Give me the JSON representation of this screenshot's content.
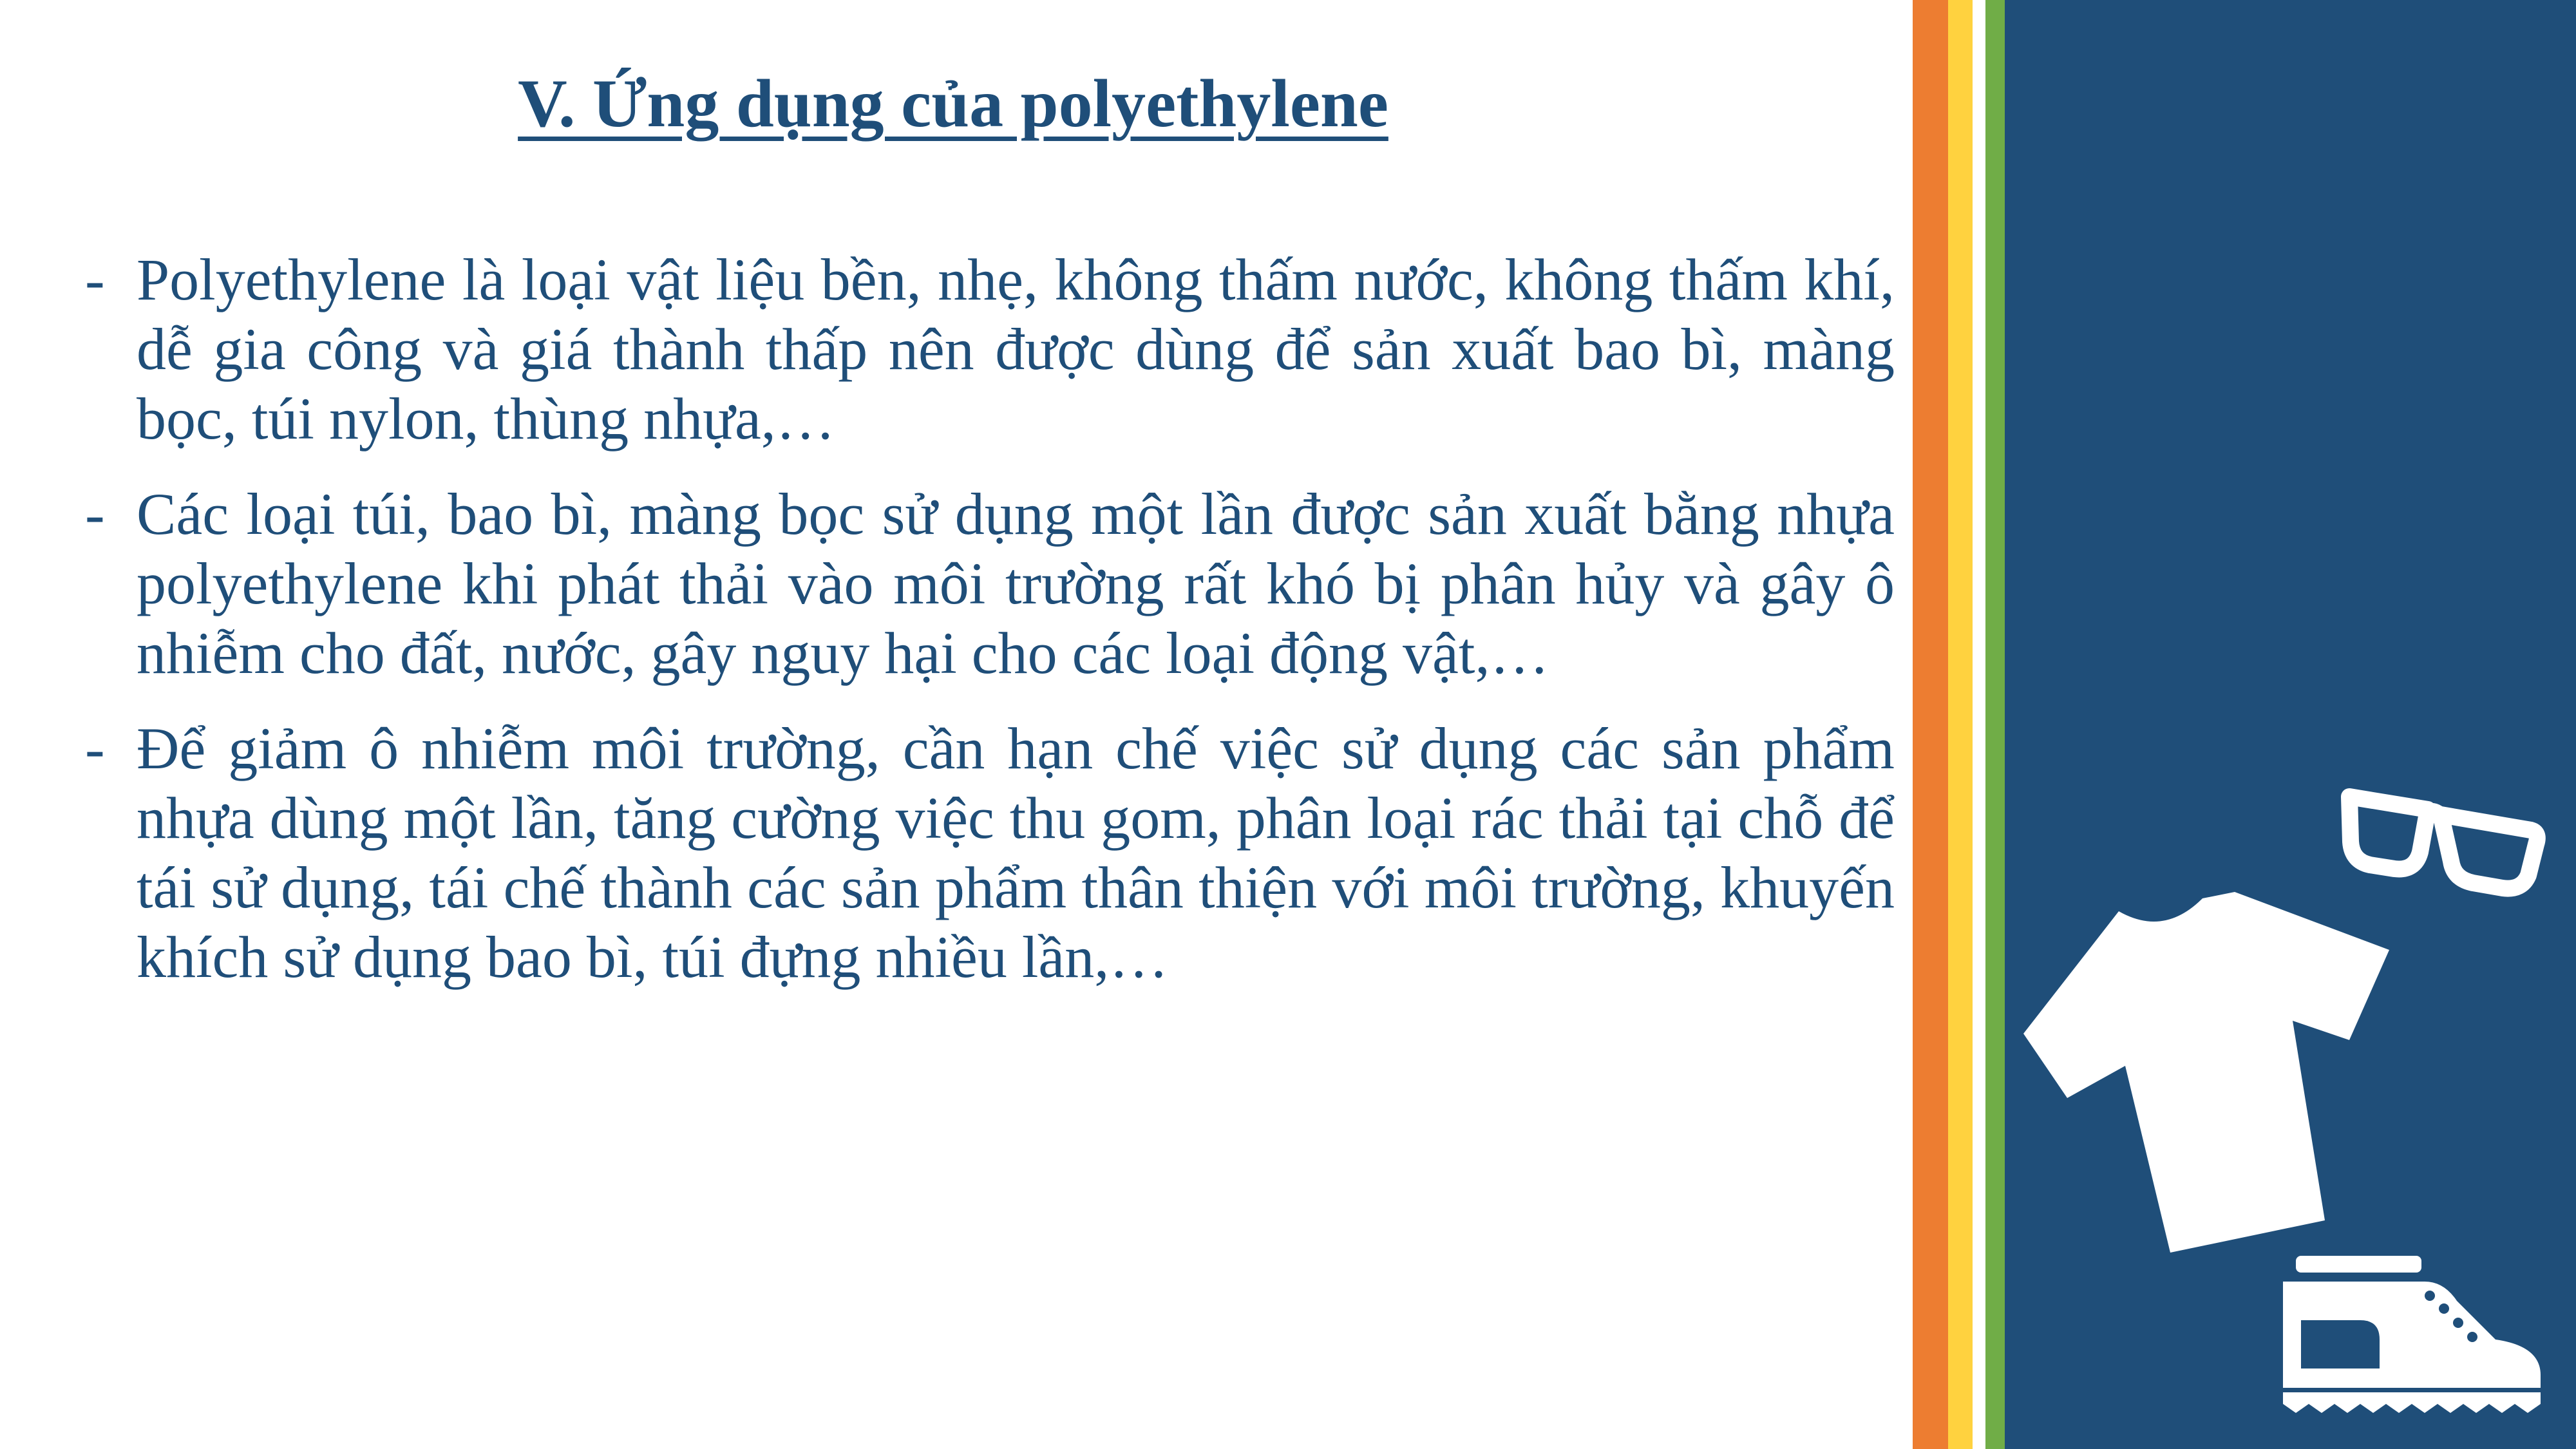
{
  "slide": {
    "title": "V. Ứng dụng của polyethylene",
    "bullet_marker": "-",
    "bullets": [
      "Polyethylene là loại vật liệu bền, nhẹ, không thấm nước, không thấm khí, dễ gia công và giá thành thấp nên được dùng để sản xuất bao bì, màng bọc, túi nylon, thùng nhựa,…",
      "Các loại túi, bao bì, màng bọc sử dụng một lần được sản xuất bằng nhựa polyethylene khi phát thải vào môi trường rất khó bị phân hủy và gây ô nhiễm cho đất, nước, gây nguy hại cho các loại động vật,…",
      "Để giảm ô nhiễm môi trường, cần hạn chế việc sử dụng các sản phẩm nhựa dùng một lần, tăng cường việc thu gom, phân loại rác thải tại chỗ để tái sử dụng, tái chế thành các sản phẩm thân thiện với môi trường, khuyến khích sử dụng bao bì, túi đựng nhiều lần,…"
    ]
  },
  "decoration": {
    "icons": [
      "glasses-icon",
      "tshirt-icon",
      "shoe-icon"
    ],
    "colors": {
      "text": "#1f4e79",
      "panel": "#1f4e79",
      "stripe_orange": "#ed7d31",
      "stripe_yellow": "#ffd23f",
      "stripe_green": "#70ad47"
    }
  }
}
